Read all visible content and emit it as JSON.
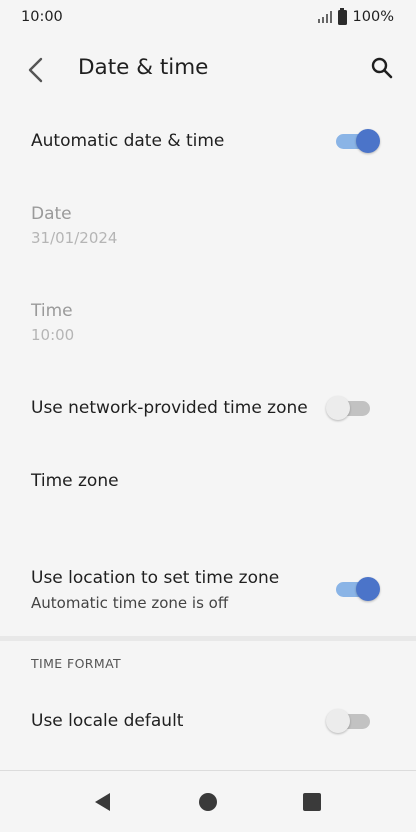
{
  "status_bar": {
    "time": "10:00",
    "battery": "100%"
  },
  "app_bar": {
    "title": "Date & time"
  },
  "settings": {
    "automatic_date_time": {
      "title": "Automatic date & time",
      "enabled": true
    },
    "date": {
      "title": "Date",
      "value": "31/01/2024"
    },
    "time": {
      "title": "Time",
      "value": "10:00"
    },
    "network_time_zone": {
      "title": "Use network-provided time zone",
      "enabled": false
    },
    "time_zone": {
      "title": "Time zone"
    },
    "location_time_zone": {
      "title": "Use location to set time zone",
      "subtitle": "Automatic time zone is off",
      "enabled": true
    }
  },
  "time_format": {
    "header": "TIME FORMAT",
    "locale_default": {
      "title": "Use locale default",
      "enabled": false
    }
  },
  "colors": {
    "accent": "#4b74c9",
    "accent_track": "#8ab4e6",
    "background": "#f5f5f5"
  }
}
